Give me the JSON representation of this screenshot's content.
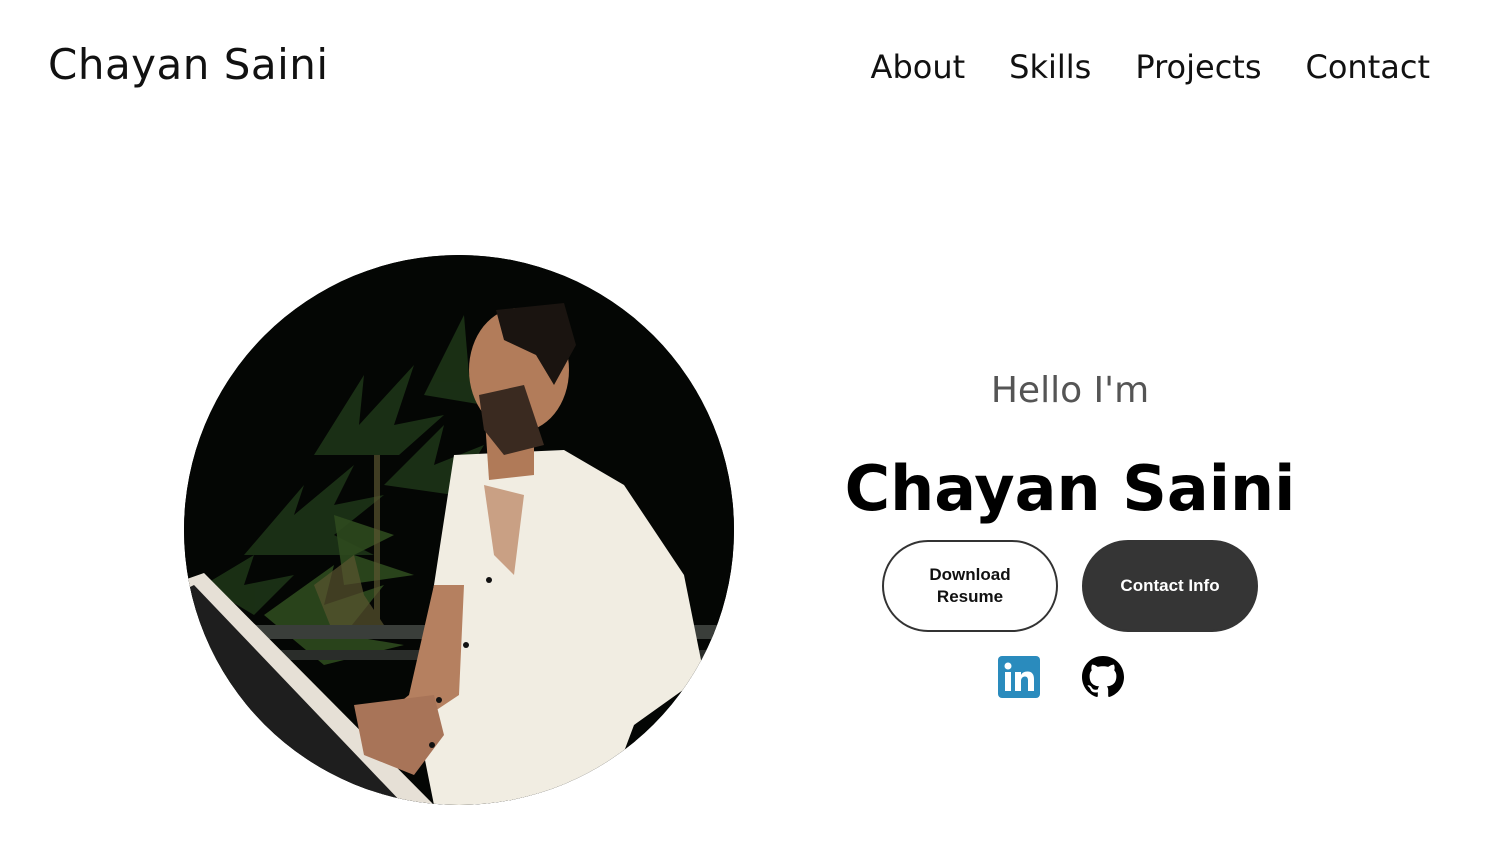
{
  "header": {
    "logo": "Chayan Saini",
    "nav": [
      {
        "label": "About"
      },
      {
        "label": "Skills"
      },
      {
        "label": "Projects"
      },
      {
        "label": "Contact"
      }
    ]
  },
  "hero": {
    "greeting": "Hello I'm",
    "name": "Chayan Saini",
    "buttons": {
      "resume": "Download Resume",
      "contact": "Contact Info"
    },
    "socials": [
      {
        "icon": "linkedin-icon",
        "color": "#2a8bbd"
      },
      {
        "icon": "github-icon",
        "color": "#000000"
      }
    ]
  },
  "colors": {
    "background": "#ffffff",
    "text": "#111111",
    "muted": "#555555",
    "button_dark": "#353535"
  }
}
